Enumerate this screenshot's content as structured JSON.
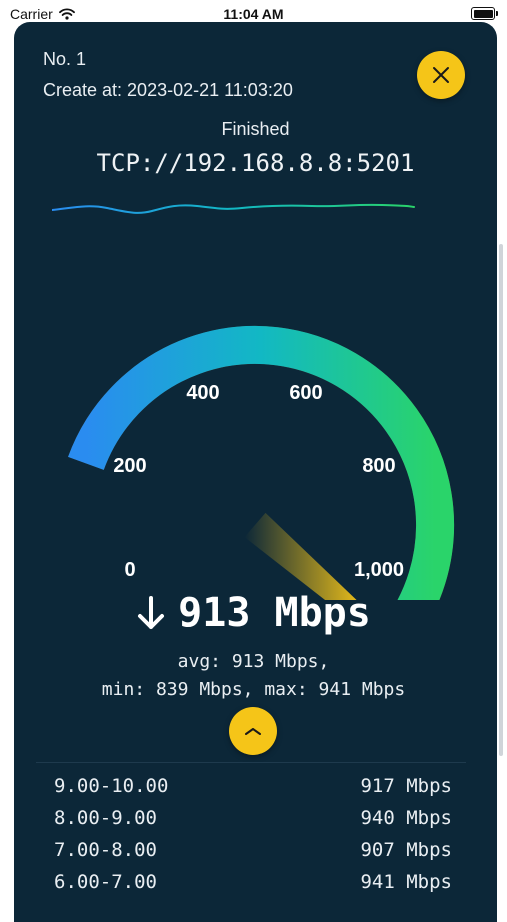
{
  "status_bar": {
    "carrier": "Carrier",
    "time": "11:04 AM"
  },
  "header": {
    "number": "No. 1",
    "created": "Create at: 2023-02-21 11:03:20",
    "status": "Finished",
    "address": "TCP://192.168.8.8:5201"
  },
  "gauge": {
    "ticks": [
      "0",
      "200",
      "400",
      "600",
      "800",
      "1,000"
    ],
    "min": 0,
    "max": 1000,
    "value": 913,
    "colors": {
      "low": "#2a8cf0",
      "mid": "#12b8c4",
      "high": "#2ad46a",
      "needle": "#f5c518",
      "track": "#5a5a44"
    }
  },
  "result": {
    "speed": "913 Mbps",
    "avg": "avg: 913 Mbps,",
    "min_max": "min: 839 Mbps, max: 941 Mbps"
  },
  "intervals": [
    {
      "range": "9.00-10.00",
      "rate": "917 Mbps"
    },
    {
      "range": "8.00-9.00",
      "rate": "940 Mbps"
    },
    {
      "range": "7.00-8.00",
      "rate": "907 Mbps"
    },
    {
      "range": "6.00-7.00",
      "rate": "941 Mbps"
    }
  ],
  "accent": "#f5c518"
}
